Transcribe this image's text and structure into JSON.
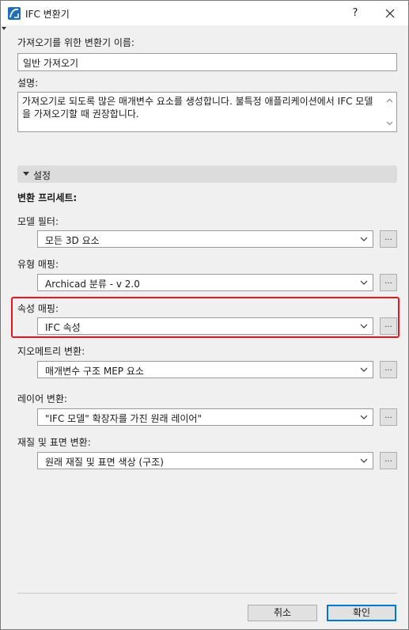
{
  "window": {
    "title": "IFC 변환기",
    "help_label": "?",
    "accent_color": "#0078d7",
    "highlight_color": "#e8141b"
  },
  "name_field": {
    "label": "가져오기를 위한 변환기 이름:",
    "value": "일반 가져오기"
  },
  "description": {
    "label": "설명:",
    "text": "가져오기로 되도록 많은 매개변수 요소를 생성합니다. 불특정 애플리케이션에서 IFC 모델을 가져오기할 때 권장합니다."
  },
  "settings": {
    "section_title": "설정",
    "presets_heading": "변환 프리세트:",
    "more_label": "...",
    "rows": [
      {
        "label": "모델 필터:",
        "value": "모든 3D 요소"
      },
      {
        "label": "유형 매핑:",
        "value": "Archicad 분류 - v 2.0"
      },
      {
        "label": "속성 매핑:",
        "value": "IFC 속성"
      },
      {
        "label": "지오메트리 변환:",
        "value": "매개변수 구조 MEP 요소"
      },
      {
        "label": "레이어 변환:",
        "value": "\"IFC 모델\" 확장자를 가진 원래 레이어\""
      },
      {
        "label": "재질 및 표면 변환:",
        "value": "원래 재질 및 표면 색상 (구조)"
      }
    ]
  },
  "footer": {
    "cancel_label": "취소",
    "ok_label": "확인"
  }
}
